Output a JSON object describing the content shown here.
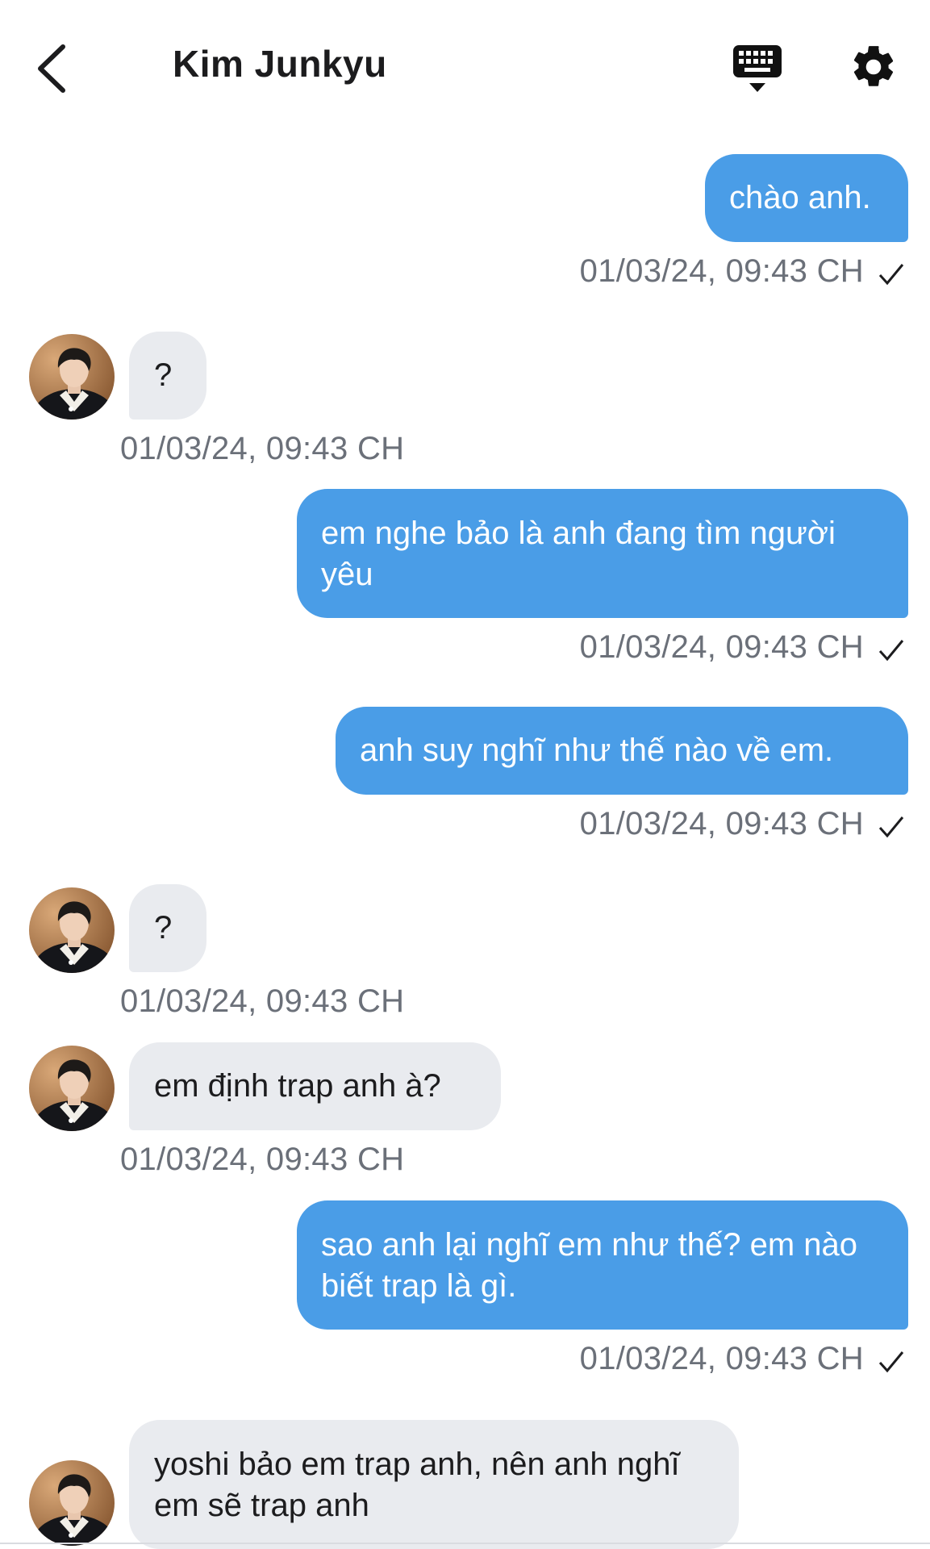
{
  "header": {
    "title": "Kim Junkyu",
    "back_icon": "chevron-left-icon",
    "keyboard_icon": "keyboard-icon",
    "settings_icon": "gear-icon"
  },
  "colors": {
    "outgoing_bubble": "#4a9de7",
    "incoming_bubble": "#e9ebef",
    "timestamp": "#6b7079"
  },
  "messages": [
    {
      "direction": "outgoing",
      "text": "chào anh.",
      "time": "01/03/24, 09:43 CH",
      "status": "sent"
    },
    {
      "direction": "incoming",
      "text": "?",
      "time": "01/03/24, 09:43 CH"
    },
    {
      "direction": "outgoing",
      "text": "em nghe bảo là anh đang tìm người yêu",
      "time": "01/03/24, 09:43 CH",
      "status": "sent"
    },
    {
      "direction": "outgoing",
      "text": "anh suy nghĩ như thế nào về em.",
      "time": "01/03/24, 09:43 CH",
      "status": "sent"
    },
    {
      "direction": "incoming",
      "text": "?",
      "time": "01/03/24, 09:43 CH"
    },
    {
      "direction": "incoming",
      "text": "em định trap anh à?",
      "time": "01/03/24, 09:43 CH"
    },
    {
      "direction": "outgoing",
      "text": "sao anh lại nghĩ em như thế? em nào biết trap là gì.",
      "time": "01/03/24, 09:43 CH",
      "status": "sent"
    },
    {
      "direction": "incoming",
      "text": "yoshi bảo em trap anh, nên anh nghĩ em sẽ trap anh",
      "time": ""
    }
  ]
}
